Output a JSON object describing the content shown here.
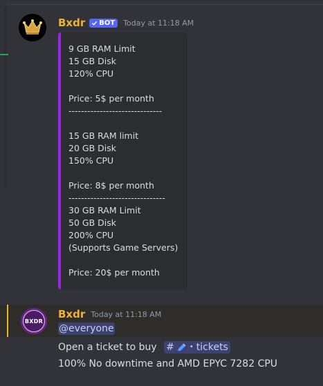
{
  "message1": {
    "username": "Bxdr",
    "bot_badge": "BOT",
    "timestamp": "Today at 11:18 AM",
    "embed": {
      "accent_color": "#9b25e3",
      "lines": [
        "9 GB RAM Limit",
        "15 GB Disk",
        "120% CPU",
        "",
        "Price: 5$ per month",
        "------------------------------",
        "",
        "15 GB RAM limit",
        "20 GB Disk",
        "150% CPU",
        "",
        "Price: 8$ per month",
        "-------------------------------",
        "30 GB RAM Limit",
        "50 GB Disk",
        "200% CPU",
        "(Supports Game Servers)",
        "",
        "Price: 20$ per month"
      ]
    }
  },
  "message2": {
    "username": "Bxdr",
    "timestamp": "Today at 11:18 AM",
    "avatar_text": "BXDR",
    "mention": "@everyone",
    "line1_text": "Open a ticket to buy",
    "channel_mention": "tickets",
    "line2": "100% No downtime and AMD EPYC 7282 CPU"
  }
}
